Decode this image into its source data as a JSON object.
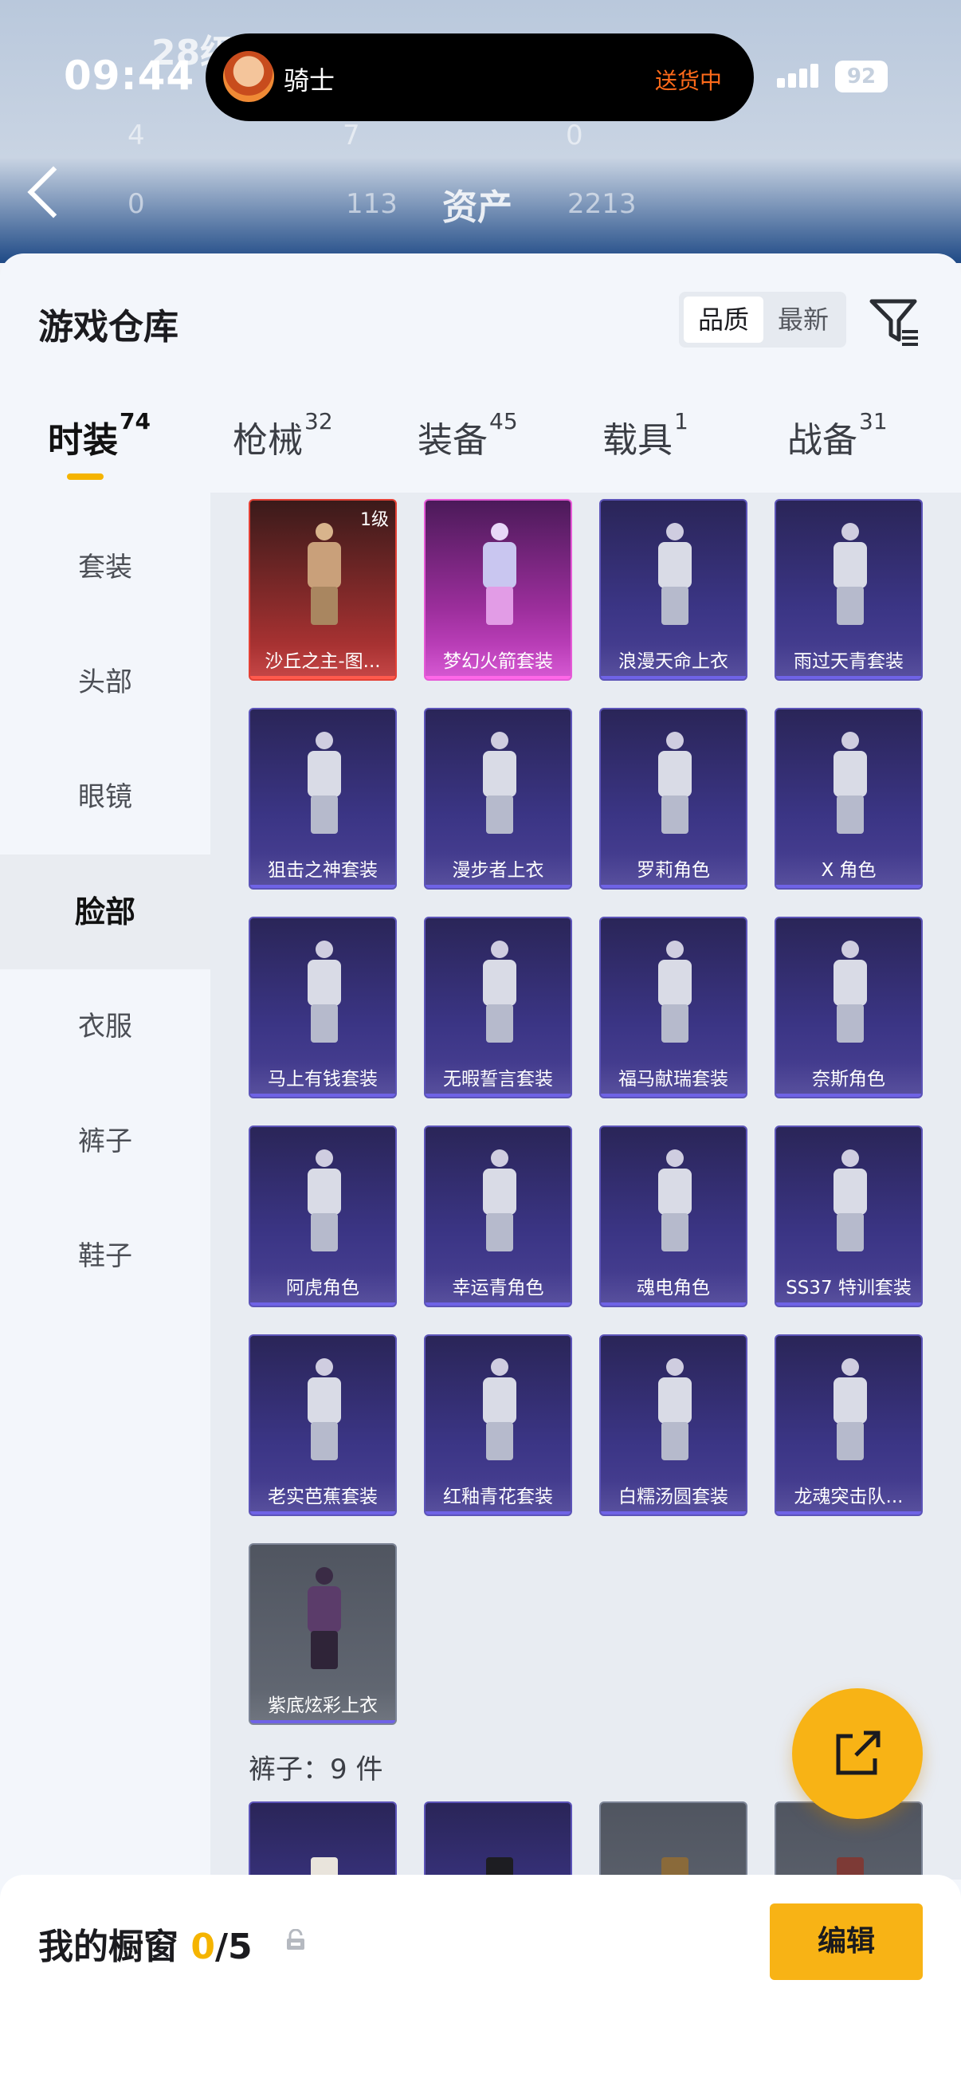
{
  "status_bar": {
    "time": "09:44",
    "battery": "92"
  },
  "dynamic_island": {
    "name": "骑士",
    "status": "送货中"
  },
  "header_bg": {
    "level": "28级",
    "stats_row1": [
      "4",
      "7",
      "0"
    ],
    "stats_row2": [
      "0",
      "113",
      "2213"
    ],
    "title": "资产"
  },
  "warehouse": {
    "title": "游戏仓库",
    "sort_options": [
      "品质",
      "最新"
    ],
    "categories": [
      {
        "label": "时装",
        "count": "74"
      },
      {
        "label": "枪械",
        "count": "32"
      },
      {
        "label": "装备",
        "count": "45"
      },
      {
        "label": "载具",
        "count": "1"
      },
      {
        "label": "战备",
        "count": "31"
      }
    ],
    "sidebar": [
      "套装",
      "头部",
      "眼镜",
      "脸部",
      "衣服",
      "裤子",
      "鞋子"
    ],
    "items": [
      {
        "name": "沙丘之主-图...",
        "rarity": "red",
        "level": "1级"
      },
      {
        "name": "梦幻火箭套装",
        "rarity": "pink"
      },
      {
        "name": "浪漫天命上衣",
        "rarity": "purple"
      },
      {
        "name": "雨过天青套装",
        "rarity": "purple"
      },
      {
        "name": "狙击之神套装",
        "rarity": "purple"
      },
      {
        "name": "漫步者上衣",
        "rarity": "purple"
      },
      {
        "name": "罗莉角色",
        "rarity": "purple"
      },
      {
        "name": "X 角色",
        "rarity": "purple"
      },
      {
        "name": "马上有钱套装",
        "rarity": "purple"
      },
      {
        "name": "无暇誓言套装",
        "rarity": "purple"
      },
      {
        "name": "福马献瑞套装",
        "rarity": "purple"
      },
      {
        "name": "奈斯角色",
        "rarity": "purple"
      },
      {
        "name": "阿虎角色",
        "rarity": "purple"
      },
      {
        "name": "幸运青角色",
        "rarity": "purple"
      },
      {
        "name": "魂电角色",
        "rarity": "purple"
      },
      {
        "name": "SS37 特训套装",
        "rarity": "purple"
      },
      {
        "name": "老实芭蕉套装",
        "rarity": "purple"
      },
      {
        "name": "红釉青花套装",
        "rarity": "purple"
      },
      {
        "name": "白糯汤圆套装",
        "rarity": "purple"
      },
      {
        "name": "龙魂突击队...",
        "rarity": "purple"
      },
      {
        "name": "紫底炫彩上衣",
        "rarity": "gray"
      }
    ],
    "pants_section": "裤子：9 件",
    "pants_items": [
      {
        "rarity": "purple"
      },
      {
        "rarity": "purple"
      },
      {
        "rarity": "gray"
      },
      {
        "rarity": "gray"
      }
    ]
  },
  "showcase": {
    "label": "我的橱窗",
    "count": "0",
    "total": "/5",
    "edit": "编辑"
  },
  "colors": {
    "accent": "#f8b315",
    "tab_underline": "#f5b400",
    "rarity_red": "#e44136",
    "rarity_pink": "#e65ad7",
    "rarity_purple": "#5c54b8"
  },
  "icons": [
    "back-icon",
    "filter-icon",
    "lock-icon",
    "share-icon"
  ]
}
